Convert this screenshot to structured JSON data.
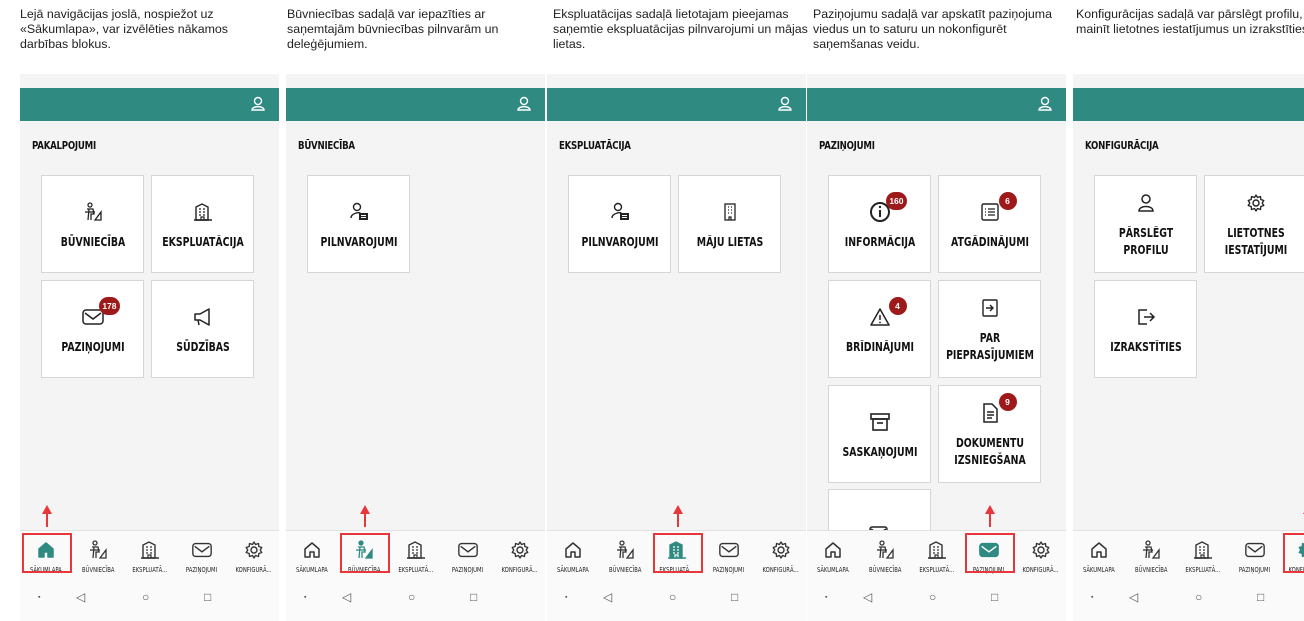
{
  "captions": [
    "Lejā navigācijas joslā,  nospiežot uz «Sākumlapa», var izvēlēties nākamos darbības blokus.",
    "Būvniecības sadaļā var iepazīties ar saņemtajām būvniecības pilnvarām un deleģējumiem.",
    "Ekspluatācijas sadaļā lietotajam pieejamas saņemtie ekspluatācijas pilnvarojumi un mājas lietas.",
    "Paziņojumu sadaļā var apskatīt paziņojuma viedus un to saturu un nokonfigurēt saņemšanas veidu.",
    "Konfigurācijas sadaļā var pārslēgt profilu, mainīt lietotnes iestatījumus un izrakstīties."
  ],
  "colors": {
    "appbar": "#2f8a82",
    "accent": "#2f8a82",
    "badge": "#9e1a1a",
    "highlight": "#e8373a"
  },
  "nav_labels": [
    "SĀKUMLAPA",
    "BŪVNIECĪBA",
    "EKSPLUATĀ...",
    "PAZIŅOJUMI",
    "KONFIGURĀ..."
  ],
  "nav_icons": [
    "home-icon",
    "construction-icon",
    "building-icon",
    "mail-icon",
    "gear-icon"
  ],
  "screens": [
    {
      "title": "PAKALPOJUMI",
      "active_nav": 0,
      "tiles": [
        {
          "label": "BŪVNIECĪBA",
          "icon": "construction-icon",
          "badge": ""
        },
        {
          "label": "EKSPLUATĀCIJA",
          "icon": "building-icon",
          "badge": ""
        },
        {
          "label": "PAZIŅOJUMI",
          "icon": "mail-icon",
          "badge": "178"
        },
        {
          "label": "SŪDZĪBAS",
          "icon": "megaphone-icon",
          "badge": ""
        }
      ]
    },
    {
      "title": "BŪVNIECĪBA",
      "active_nav": 1,
      "tiles": [
        {
          "label": "PILNVAROJUMI",
          "icon": "user-card-icon",
          "badge": ""
        }
      ]
    },
    {
      "title": "EKSPLUATĀCIJA",
      "active_nav": 2,
      "tiles": [
        {
          "label": "PILNVAROJUMI",
          "icon": "user-card-icon",
          "badge": ""
        },
        {
          "label": "MĀJU LIETAS",
          "icon": "office-building-icon",
          "badge": ""
        }
      ]
    },
    {
      "title": "PAZIŅOJUMI",
      "active_nav": 3,
      "tiles": [
        {
          "label": "INFORMĀCIJA",
          "icon": "info-icon",
          "badge": "160"
        },
        {
          "label": "ATGĀDINĀJUMI",
          "icon": "list-icon",
          "badge": "6"
        },
        {
          "label": "BRĪDINĀJUMI",
          "icon": "warning-icon",
          "badge": "4"
        },
        {
          "label": "PAR PIEPRASĪJUMIEM",
          "icon": "inbox-arrow-icon",
          "badge": ""
        },
        {
          "label": "SASKAŅOJUMI",
          "icon": "archive-icon",
          "badge": ""
        },
        {
          "label": "DOKUMENTU IZSNIEGŠANA",
          "icon": "document-icon",
          "badge": "9"
        },
        {
          "label": "",
          "icon": "mail-settings-icon",
          "badge": ""
        }
      ]
    },
    {
      "title": "KONFIGURĀCIJA",
      "active_nav": 4,
      "tiles": [
        {
          "label": "PĀRSLĒGT PROFILU",
          "icon": "user-icon",
          "badge": ""
        },
        {
          "label": "LIETOTNES IESTATĪJUMI",
          "icon": "gear-icon",
          "badge": ""
        },
        {
          "label": "IZRAKSTĪTIES",
          "icon": "logout-icon",
          "badge": ""
        }
      ]
    }
  ],
  "system_nav": [
    "▪",
    "◁",
    "○",
    "□"
  ]
}
